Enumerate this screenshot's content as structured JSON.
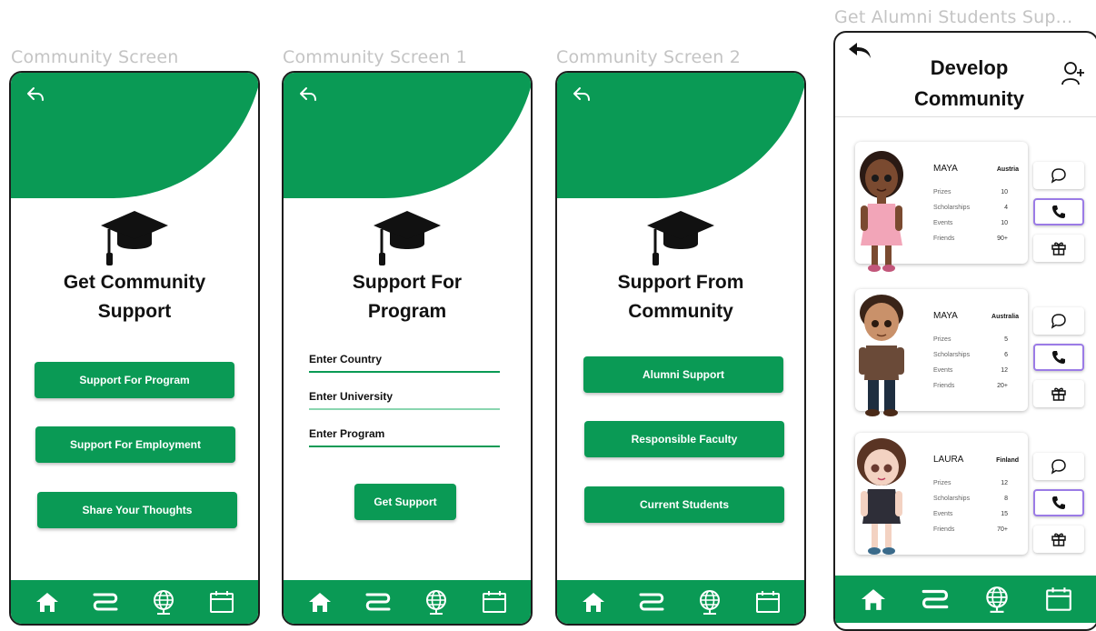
{
  "labels": [
    "Community Screen",
    "Community Screen 1",
    "Community Screen 2",
    "Get Alumni Students Sup..."
  ],
  "colors": {
    "brand_green": "#0a9a55",
    "selected_border": "#9b7be6"
  },
  "screen1": {
    "title": [
      "Get Community",
      "Support"
    ],
    "buttons": [
      "Support For Program",
      "Support For Employment",
      "Share Your Thoughts"
    ]
  },
  "screen2": {
    "title": [
      "Support For",
      "Program"
    ],
    "fields": [
      "Enter Country",
      "Enter University",
      "Enter Program"
    ],
    "button": "Get Support"
  },
  "screen3": {
    "title": [
      "Support From",
      "Community"
    ],
    "buttons": [
      "Alumni Support",
      "Responsible Faculty",
      "Current Students"
    ]
  },
  "screen4": {
    "title": [
      "Develop",
      "Community"
    ],
    "stat_labels": [
      "Prizes",
      "Scholarships",
      "Events",
      "Friends"
    ],
    "students": [
      {
        "name": "MAYA",
        "country": "Austria",
        "stats": [
          "10",
          "4",
          "10",
          "90+"
        ]
      },
      {
        "name": "MAYA",
        "country": "Australia",
        "stats": [
          "5",
          "6",
          "12",
          "20+"
        ]
      },
      {
        "name": "LAURA",
        "country": "Finland",
        "stats": [
          "12",
          "8",
          "15",
          "70+"
        ]
      }
    ]
  },
  "nav_icons": [
    "home-icon",
    "route-icon",
    "globe-icon",
    "calendar-icon"
  ]
}
